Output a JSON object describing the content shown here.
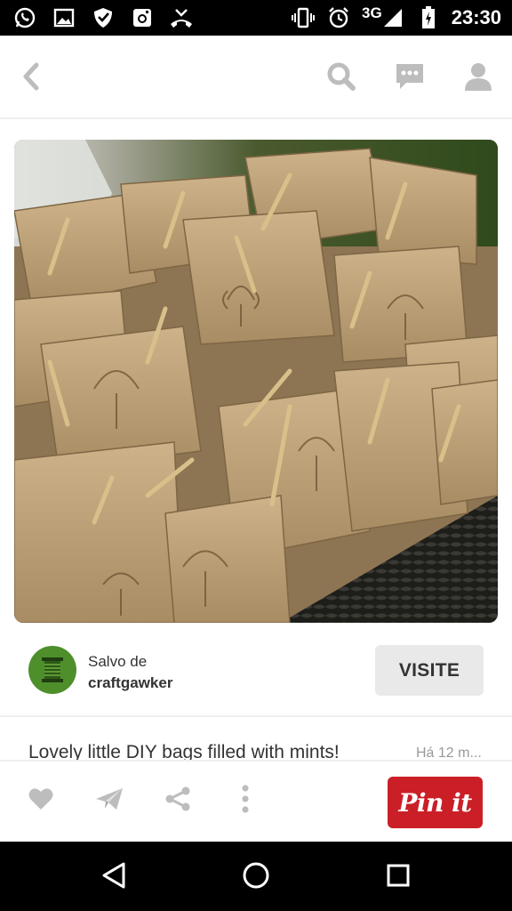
{
  "status_bar": {
    "network": "3G",
    "time": "23:30",
    "left_icons": [
      "whatsapp-icon",
      "gallery-icon",
      "shield-icon",
      "instagram-icon",
      "missed-call-icon"
    ],
    "right_icons": [
      "vibrate-icon",
      "alarm-icon",
      "signal-icon",
      "battery-icon"
    ]
  },
  "top_bar": {
    "icons": [
      "back-icon",
      "search-icon",
      "chat-icon",
      "profile-icon"
    ]
  },
  "pin": {
    "image_icon": "photo-kraft-bags"
  },
  "saved": {
    "label": "Salvo de",
    "source": "craftgawker",
    "visit_label": "VISITE"
  },
  "description": {
    "text": "Lovely little DIY bags filled with mints!",
    "time": "Há 12 m..."
  },
  "actions": {
    "icons": [
      "heart-icon",
      "send-icon",
      "share-icon",
      "more-icon"
    ],
    "pin_it_label": "Pin it"
  },
  "nav_bar": {
    "icons": [
      "nav-back-icon",
      "nav-home-icon",
      "nav-recents-icon"
    ]
  },
  "colors": {
    "accent_red": "#cb1f27",
    "icon_gray": "#bdbdbd",
    "avatar_green": "#4e8f2c",
    "visit_bg": "#e9e9e9"
  }
}
